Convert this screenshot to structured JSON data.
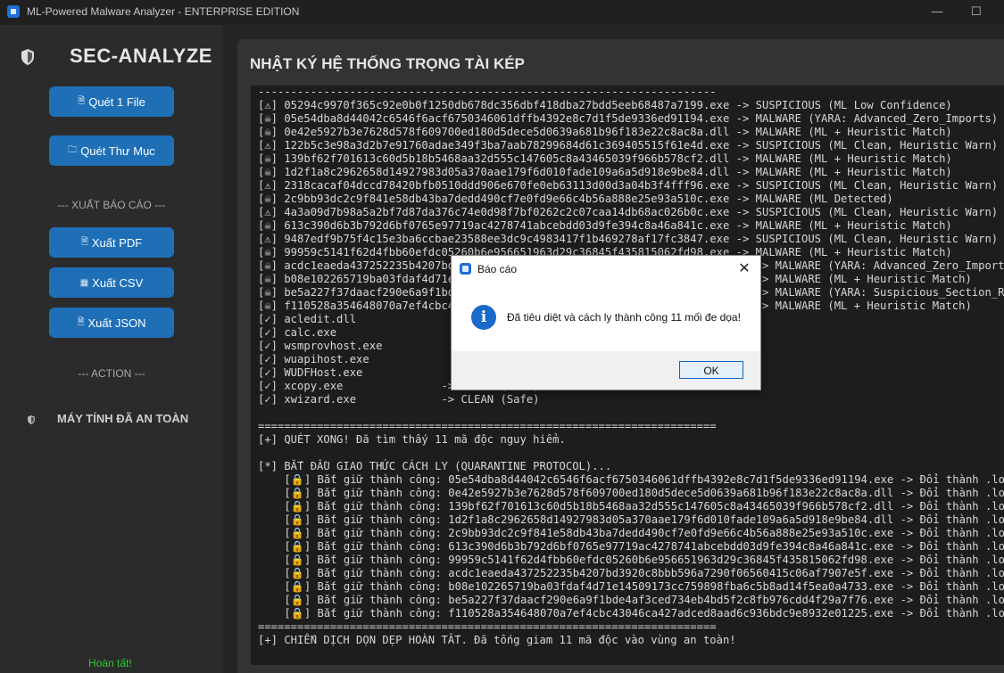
{
  "window": {
    "title": "ML-Powered Malware Analyzer - ENTERPRISE EDITION",
    "minimize_glyph": "—",
    "maximize_glyph": "☐"
  },
  "sidebar": {
    "brand": "SEC-ANALYZE",
    "buttons": {
      "scan_file": "Quét 1 File",
      "scan_folder": "Quét Thư Mục",
      "export_pdf": "Xuất PDF",
      "export_csv": "Xuất CSV",
      "export_json": "Xuất JSON"
    },
    "sections": {
      "export": "--- XUẤT BÁO CÁO ---",
      "action": "--- ACTION ---"
    },
    "status": "MÁY TÍNH ĐÃ AN TOÀN",
    "footer_status": "Hoàn tất!",
    "colors": {
      "button": "#1f6fb7",
      "footer_status": "#2ec82e"
    }
  },
  "main": {
    "title": "NHẬT KÝ HỆ THỐNG TRỌNG TÀI KÉP",
    "log_lines": [
      "----------------------------------------------------------------------",
      "[⚠] 05294c9970f365c92e0b0f1250db678dc356dbf418dba27bdd5eeb68487a7199.exe -> SUSPICIOUS (ML Low Confidence)",
      "[☠] 05e54dba8d44042c6546f6acf6750346061dffb4392e8c7d1f5de9336ed91194.exe -> MALWARE (YARA: Advanced_Zero_Imports)",
      "[☠] 0e42e5927b3e7628d578f609700ed180d5dece5d0639a681b96f183e22c8ac8a.dll -> MALWARE (ML + Heuristic Match)",
      "[⚠] 122b5c3e98a3d2b7e91760adae349f3ba7aab78299684d61c369405515f61e4d.exe -> SUSPICIOUS (ML Clean, Heuristic Warn)",
      "[☠] 139bf62f701613c60d5b18b5468aa32d555c147605c8a43465039f966b578cf2.dll -> MALWARE (ML + Heuristic Match)",
      "[☠] 1d2f1a8c2962658d14927983d05a370aae179f6d010fade109a6a5d918e9be84.dll -> MALWARE (ML + Heuristic Match)",
      "[⚠] 2318cacaf04dccd78420bfb0510ddd906e670fe0eb63113d00d3a04b3f4fff96.exe -> SUSPICIOUS (ML Clean, Heuristic Warn)",
      "[☠] 2c9bb93dc2c9f841e58db43ba7dedd490cf7e0fd9e66c4b56a888e25e93a510c.exe -> MALWARE (ML Detected)",
      "[⚠] 4a3a09d7b98a5a2bf7d87da376c74e0d98f7bf0262c2c07caa14db68ac026b0c.exe -> SUSPICIOUS (ML Clean, Heuristic Warn)",
      "[☠] 613c390d6b3b792d6bf0765e97719ac4278741abcebdd03d9fe394c8a46a841c.exe -> MALWARE (ML + Heuristic Match)",
      "[⚠] 9487edf9b75f4c15e3ba6ccbae23588ee3dc9c4983417f1b469278af17fc3847.exe -> SUSPICIOUS (ML Clean, Heuristic Warn)",
      "[☠] 99959c5141f62d4fbb60efdc05260b6e956651963d29c36845f435815062fd98.exe -> MALWARE (ML + Heuristic Match)",
      "[☠] acdc1eaeda437252235b4207bd                                              -> MALWARE (YARA: Advanced_Zero_Imports)",
      "[☠] b08e102265719ba03fdaf4d71e                                              -> MALWARE (ML + Heuristic Match)",
      "[☠] be5a227f37daacf290e6a9f1bd                                              -> MALWARE (YARA: Suspicious_Section_RWX)",
      "[☠] f110528a354648070a7ef4cbc4                                              -> MALWARE (ML + Heuristic Match)",
      "[✓] acledit.dll",
      "[✓] calc.exe",
      "[✓] wsmprovhost.exe",
      "[✓] wuapihost.exe",
      "[✓] WUDFHost.exe",
      "[✓] xcopy.exe               -> CLEAN (Safe)",
      "[✓] xwizard.exe             -> CLEAN (Safe)",
      "",
      "======================================================================",
      "[+] QUÉT XONG! Đã tìm thấy 11 mã độc nguy hiểm.",
      "",
      "[*] BẮT ĐẦU GIAO THỨC CÁCH LY (QUARANTINE PROTOCOL)...",
      "    [🔒] Bắt giữ thành công: 05e54dba8d44042c6546f6acf6750346061dffb4392e8c7d1f5de9336ed91194.exe -> Đổi thành .locked",
      "    [🔒] Bắt giữ thành công: 0e42e5927b3e7628d578f609700ed180d5dece5d0639a681b96f183e22c8ac8a.dll -> Đổi thành .locked",
      "    [🔒] Bắt giữ thành công: 139bf62f701613c60d5b18b5468aa32d555c147605c8a43465039f966b578cf2.dll -> Đổi thành .locked",
      "    [🔒] Bắt giữ thành công: 1d2f1a8c2962658d14927983d05a370aae179f6d010fade109a6a5d918e9be84.dll -> Đổi thành .locked",
      "    [🔒] Bắt giữ thành công: 2c9bb93dc2c9f841e58db43ba7dedd490cf7e0fd9e66c4b56a888e25e93a510c.exe -> Đổi thành .locked",
      "    [🔒] Bắt giữ thành công: 613c390d6b3b792d6bf0765e97719ac4278741abcebdd03d9fe394c8a46a841c.exe -> Đổi thành .locked",
      "    [🔒] Bắt giữ thành công: 99959c5141f62d4fbb60efdc05260b6e956651963d29c36845f435815062fd98.exe -> Đổi thành .locked",
      "    [🔒] Bắt giữ thành công: acdc1eaeda437252235b4207bd3920c8bbb596a7290f06560415c06af7907e5f.exe -> Đổi thành .locked",
      "    [🔒] Bắt giữ thành công: b08e102265719ba03fdaf4d71e14509173cc759898fba6c5b8ad14f5ea0a4733.exe -> Đổi thành .locked",
      "    [🔒] Bắt giữ thành công: be5a227f37daacf290e6a9f1bde4af3ced734eb4bd5f2c8fb976cdd4f29a7f76.exe -> Đổi thành .locked",
      "    [🔒] Bắt giữ thành công: f110528a354648070a7ef4cbc43046ca427adced8aad6c936bdc9e8932e01225.exe -> Đổi thành .locked",
      "======================================================================",
      "[+] CHIẾN DỊCH DỌN DẸP HOÀN TẤT. Đã tống giam 11 mã độc vào vùng an toàn!"
    ]
  },
  "dialog": {
    "title": "Báo cáo",
    "close_glyph": "✕",
    "info_glyph": "i",
    "message": "Đã tiêu diệt và cách ly thành công 11 mối đe dọa!",
    "ok_label": "OK"
  },
  "icons": {
    "scan_file": "file-icon",
    "scan_folder": "folder-icon",
    "export_pdf": "pdf-icon",
    "export_csv": "csv-icon",
    "export_json": "json-icon",
    "brand": "shield-icon",
    "status": "shield-icon"
  }
}
